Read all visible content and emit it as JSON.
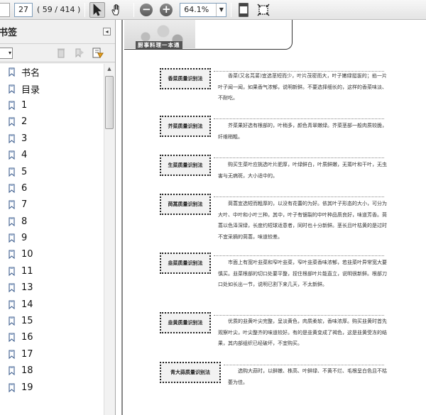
{
  "toolbar": {
    "page_number": "27",
    "page_count": "( 59 / 414 )",
    "zoom": "64.1%"
  },
  "panel": {
    "title": "书签",
    "collapse_glyph": "◂"
  },
  "bookmarks": [
    {
      "label": "书名"
    },
    {
      "label": "目录"
    },
    {
      "label": "1"
    },
    {
      "label": "2"
    },
    {
      "label": "3"
    },
    {
      "label": "4"
    },
    {
      "label": "5"
    },
    {
      "label": "6"
    },
    {
      "label": "7"
    },
    {
      "label": "8"
    },
    {
      "label": "9"
    },
    {
      "label": "10"
    },
    {
      "label": "11"
    },
    {
      "label": "13"
    },
    {
      "label": "14"
    },
    {
      "label": "15"
    },
    {
      "label": "16"
    },
    {
      "label": "17"
    },
    {
      "label": "18"
    },
    {
      "label": "19"
    }
  ],
  "document": {
    "header_title": "厨事料理一本通",
    "sections": [
      {
        "label": "香菜质量识别法",
        "text": "香菜(又名芫荽)宜选茎短而少，叶片茂密而大，叶子嫩绿挺拔的；掐一片叶子闻一闻，如果香气浓郁，说明新鲜。不要选择细长的，这样的香菜味淡、不耐吃。"
      },
      {
        "label": "芥菜质量识别法",
        "text": "芥菜果好选有根部的，叶稍多，颜色青翠嫩绿。芥菜茎部一般肉质较脆，纤维稍粗。"
      },
      {
        "label": "生菜质量识别法",
        "text": "购买生菜叶应挑选叶片肥厚，叶绿鲜白，叶质鲜嫩，无蔫叶和干叶，无虫害与无病斑，大小适中的。"
      },
      {
        "label": "茼蒿质量识别法",
        "text": "茼蒿宜选短而粗厚的，以没有花蕾的为好。依其叶子形态的大小，可分为大叶、中叶和小叶三种。其中，叶子有锯裂的中叶种品质良好，味道芳香。茼蒿以色泽深绿，长度约短球适意者，同时也十分新鲜。茎长且叶枯黄的是过时不宜采摘的茼蒿，味道较差。"
      },
      {
        "label": "韭菜质量识别法",
        "text": "市面上有宽叶韭菜和窄叶韭菜，窄叶韭菜香味浓郁，若韭菜叶异常宽大要慎买。韭菜根部的切口处要平整，捏住根部叶片能直立，说明很新鲜。根部刀口处如长出一节，说明已割下来几天，不太新鲜。"
      },
      {
        "label": "韭黄质量识别法",
        "text": "优质的韭黄叶尖完整，呈淡黄色，肉质柔软，香味浓厚。购买韭黄时首先观察叶尖，叶尖整齐的味道较好。有的是韭黄变成了褐色，这是韭黄受冻的结果，其内部组织已经破坏，不宜购买。"
      },
      {
        "label": "青大蒜质量识别法",
        "text": "选购大蒜时，以鲜嫩、株高、叶鲜绿、不黄不烂、毛根呈白色且不枯萎为佳。"
      }
    ]
  }
}
